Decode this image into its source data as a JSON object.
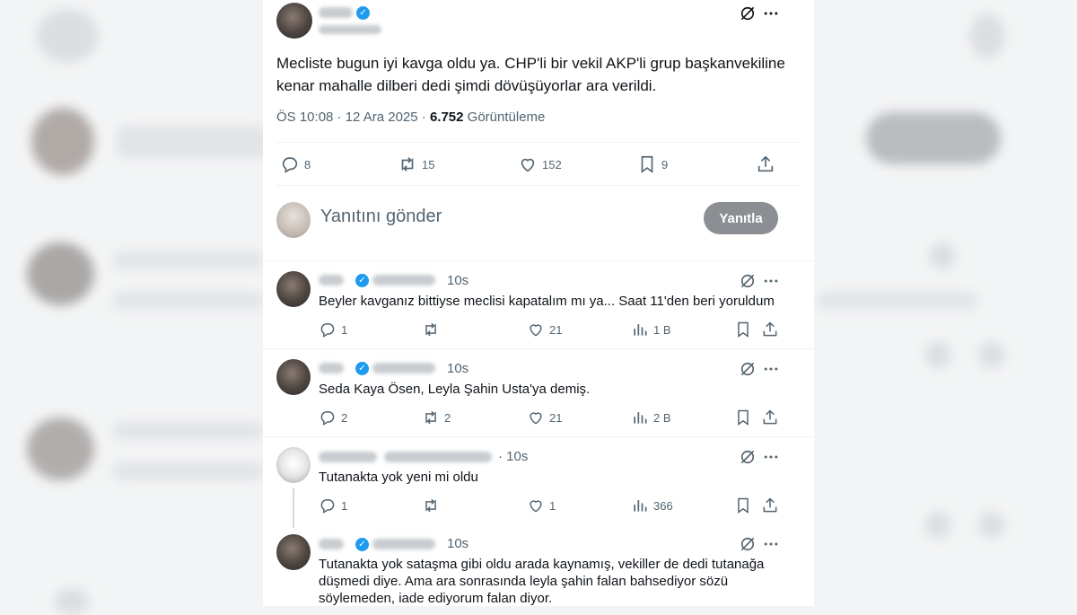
{
  "main_tweet": {
    "text": "Mecliste bugun iyi kavga oldu ya. CHP'li bir vekil AKP'li grup başkanvekiline kenar mahalle dilberi dedi şimdi dövüşüyorlar ara verildi.",
    "time": "ÖS 10:08 · 12 Ara 2025 · ",
    "views_count": "6.752",
    "views_label": " Görüntüleme",
    "actions": {
      "replies": "8",
      "retweets": "15",
      "likes": "152",
      "bookmarks": "9"
    }
  },
  "composer": {
    "placeholder": "Yanıtını gönder",
    "button_label": "Yanıtla"
  },
  "replies": [
    {
      "time": "10s",
      "text": "Beyler kavganız bittiyse meclisi kapatalım mı ya... Saat 11'den beri yoruldum",
      "replies": "1",
      "retweets": "",
      "likes": "21",
      "views": "1 B"
    },
    {
      "time": "10s",
      "text": "Seda Kaya Ösen, Leyla Şahin Usta'ya demiş.",
      "replies": "2",
      "retweets": "2",
      "likes": "21",
      "views": "2 B"
    },
    {
      "time": "· 10s",
      "text": "Tutanakta yok yeni mi oldu",
      "replies": "1",
      "retweets": "",
      "likes": "1",
      "views": "366"
    },
    {
      "time": "10s",
      "text": "Tutanakta yok sataşma gibi oldu arada kaynamış, vekiller de dedi tutanağa düşmedi diye. Ama ara sonrasında leyla şahin falan bahsediyor sözü söylemeden, iade ediyorum falan diyor."
    }
  ],
  "colors": {
    "accent": "#1d9bf0",
    "muted_text": "#536471",
    "button_disabled": "#8b8f93"
  },
  "icons": [
    "grok-icon",
    "more-icon",
    "reply-icon",
    "retweet-icon",
    "like-icon",
    "bookmark-icon",
    "share-icon",
    "views-icon",
    "verified-icon"
  ]
}
